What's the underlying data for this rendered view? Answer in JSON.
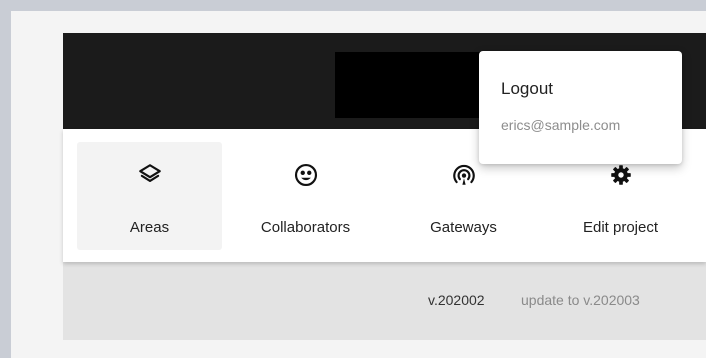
{
  "menu": {
    "logout_label": "Logout",
    "email": "erics@sample.com"
  },
  "nav": {
    "items": [
      {
        "label": "Areas",
        "icon": "layers-icon",
        "active": true
      },
      {
        "label": "Collaborators",
        "icon": "face-icon",
        "active": false
      },
      {
        "label": "Gateways",
        "icon": "gateway-icon",
        "active": false
      },
      {
        "label": "Edit project",
        "icon": "gear-icon",
        "active": false
      }
    ]
  },
  "footer": {
    "version": "v.202002",
    "update_label": "update to v.202003"
  },
  "colors": {
    "topbar": "#1b1b1b",
    "nav_background": "#ffffff",
    "active_item": "#f3f3f3",
    "app_background": "#e3e3e3",
    "page_frame": "#c9cdd5",
    "muted_text": "#8a8a8a"
  }
}
